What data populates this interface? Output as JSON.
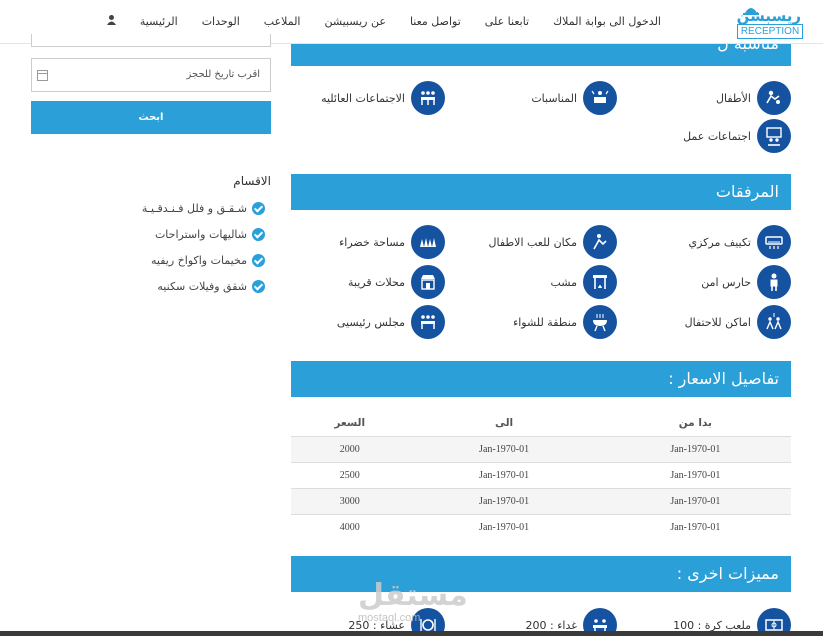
{
  "nav": {
    "logo_ar": "ريسبشن",
    "logo_en": "RECEPTION",
    "items": [
      "الرئيسية",
      "الوحدات",
      "الملاعب",
      "عن ريسبيشن",
      "تواصل معنا",
      "تابعنا على",
      "الدخول الى بوابة الملاك"
    ]
  },
  "sections": {
    "suitable_title": "مناسبة ل",
    "suitable": [
      "الأطفال",
      "المناسبات",
      "الاجتماعات العائليه",
      "اجتماعات عمل"
    ],
    "facilities_title": "المرفقات",
    "facilities": [
      "تكييف مركزي",
      "مكان للعب الاطفال",
      "مساحة خضراء",
      "حارس امن",
      "مشب",
      "محلات قريبة",
      "اماكن للاحتفال",
      "منطقة للشواء",
      "مجلس رئيسيى"
    ],
    "prices_title": "تفاصيل الاسعار :",
    "prices_headers": [
      "بدا من",
      "الى",
      "السعر"
    ],
    "prices_rows": [
      [
        "01-Jan-1970",
        "01-Jan-1970",
        "2000"
      ],
      [
        "01-Jan-1970",
        "01-Jan-1970",
        "2500"
      ],
      [
        "01-Jan-1970",
        "01-Jan-1970",
        "3000"
      ],
      [
        "01-Jan-1970",
        "01-Jan-1970",
        "4000"
      ]
    ],
    "extras_title": "مميزات اخرى :",
    "extras": [
      "ملعب كرة : 100",
      "غداء : 200",
      "عشاء : 250"
    ]
  },
  "sidebar": {
    "date_placeholder": "اقرب تاريخ للحجز",
    "search_button": "ابحث",
    "categories_title": "الاقسام",
    "categories": [
      "شـقـق و فلل فـنـدقـيـة",
      "شاليهات واستراحات",
      "مخيمات واكواخ ريفيه",
      "شقق وفيلات سكنيه"
    ]
  },
  "watermark": {
    "ar": "مستقل",
    "en": "mostaql.com"
  },
  "colors": {
    "accent": "#2a9fd8",
    "icon_bg": "#1553a0"
  }
}
